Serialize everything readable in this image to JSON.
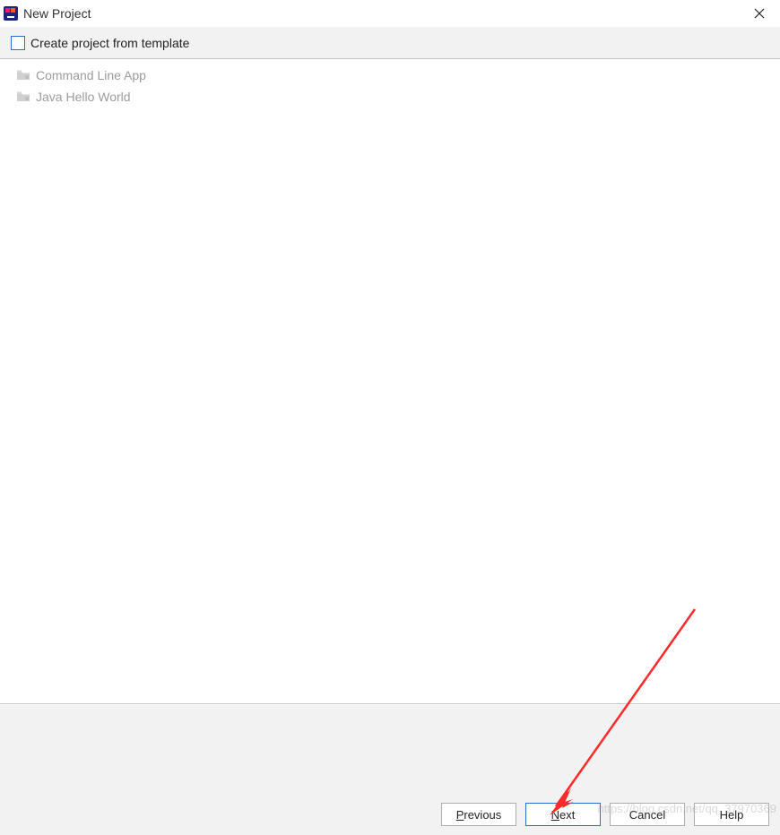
{
  "titlebar": {
    "title": "New Project"
  },
  "options": {
    "create_from_template_label": "Create project from template",
    "create_from_template_checked": false
  },
  "templates": [
    {
      "label": "Command Line App"
    },
    {
      "label": "Java Hello World"
    }
  ],
  "buttons": {
    "previous": "Previous",
    "next": "Next",
    "cancel": "Cancel",
    "help": "Help"
  },
  "watermark": "https://blog.csdn.net/qq_37970369"
}
